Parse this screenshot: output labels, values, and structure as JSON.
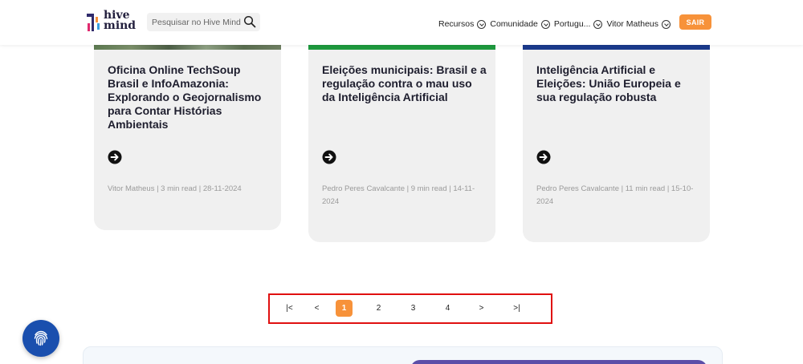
{
  "header": {
    "logo": {
      "line1": "hive",
      "line2": "mind"
    },
    "search": {
      "placeholder": "Pesquisar no Hive Mind",
      "value": ""
    },
    "nav": [
      {
        "label": "Recursos"
      },
      {
        "label": "Comunidade"
      },
      {
        "label": "Portugu..."
      },
      {
        "label": "Vitor Matheus"
      }
    ],
    "logout_label": "SAIR"
  },
  "cards": [
    {
      "title": "Oficina Online TechSoup Brasil e InfoAmazonia: Explorando o Geojornalismo para Contar Histórias Ambientais",
      "meta": "Vitor Matheus | 3 min read | 28-11-2024",
      "accent": "#4a6b4a"
    },
    {
      "title": "Eleições municipais: Brasil e a regulação contra o mau uso da Inteligência Artificial",
      "meta": "Pedro Peres Cavalcante | 9 min read | 14-11-2024",
      "accent": "#1e9a3e"
    },
    {
      "title": "Inteligência Artificial e Eleições: União Europeia e sua regulação robusta",
      "meta": "Pedro Peres Cavalcante | 11 min read | 15-10-2024",
      "accent": "#1b3a8c"
    }
  ],
  "pagination": {
    "first": "|<",
    "prev": "<",
    "pages": [
      "1",
      "2",
      "3",
      "4"
    ],
    "current": "1",
    "next": ">",
    "last": ">|"
  },
  "colors": {
    "accent_orange": "#f7923a",
    "fab_blue": "#1a4fae",
    "highlight_red": "#e01010",
    "bottom_purple": "#5b4ea8"
  },
  "icons": {
    "search": "search-icon",
    "chevron": "chevron-down-icon",
    "card_arrow": "arrow-right-circle-icon",
    "fab": "fingerprint-icon"
  }
}
